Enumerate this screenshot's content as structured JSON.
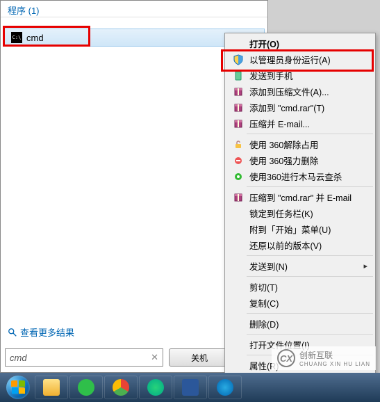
{
  "start_panel": {
    "header": "程序 (1)",
    "cmd_label": "cmd",
    "see_more": "查看更多结果",
    "search_value": "cmd",
    "shutdown_label": "关机"
  },
  "context_menu": {
    "open": "打开(O)",
    "run_as_admin": "以管理员身份运行(A)",
    "send_to_phone": "发送到手机",
    "add_to_archive": "添加到压缩文件(A)...",
    "add_to_cmd_rar": "添加到 \"cmd.rar\"(T)",
    "compress_email": "压缩并 E-mail...",
    "unlock_360": "使用 360解除占用",
    "force_del_360": "使用 360强力删除",
    "trojan_360": "使用360进行木马云查杀",
    "compress_rar_email": "压缩到 \"cmd.rar\" 并 E-mail",
    "pin_taskbar": "锁定到任务栏(K)",
    "pin_start": "附到「开始」菜单(U)",
    "restore_prev": "还原以前的版本(V)",
    "send_to": "发送到(N)",
    "cut": "剪切(T)",
    "copy": "复制(C)",
    "delete": "删除(D)",
    "open_location": "打开文件位置(I)",
    "properties": "属性(R)"
  },
  "watermark": {
    "logo": "CX",
    "name": "创新互联",
    "sub": "CHUANG XIN HU LIAN"
  }
}
